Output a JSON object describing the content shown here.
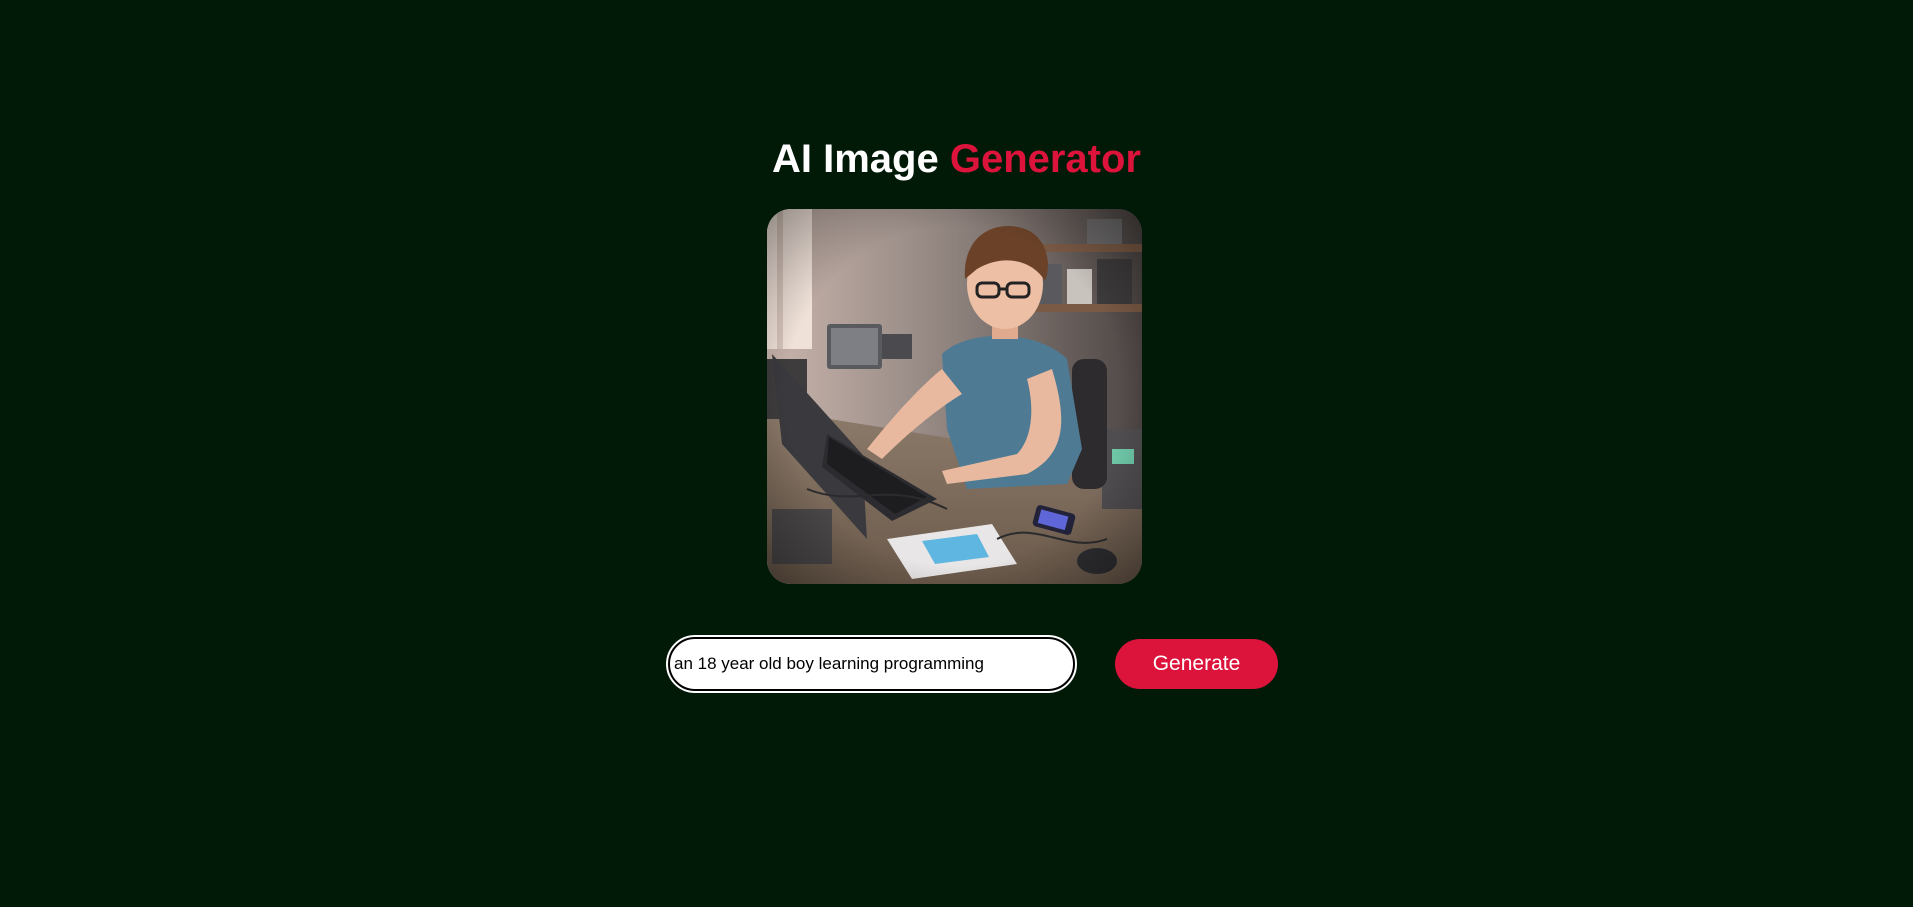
{
  "header": {
    "title_part1": "AI Image ",
    "title_part2": "Generator"
  },
  "generated_image": {
    "alt": "an 18 year old boy learning programming"
  },
  "prompt": {
    "value": "an 18 year old boy learning programming",
    "placeholder": ""
  },
  "actions": {
    "generate_label": "Generate"
  },
  "colors": {
    "background": "#001a07",
    "accent": "#dc143c",
    "text": "#ffffff"
  }
}
